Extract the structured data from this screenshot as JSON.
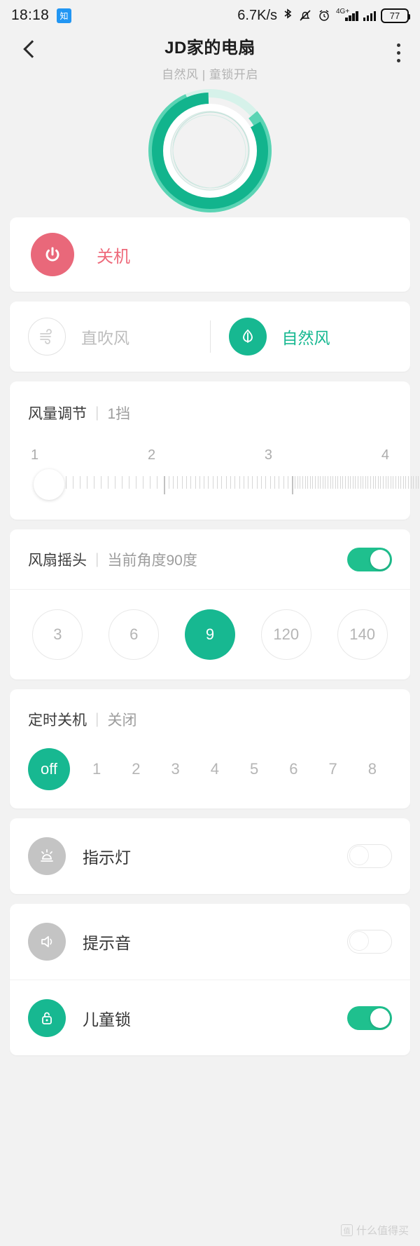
{
  "statusbar": {
    "time": "18:18",
    "app_badge": "知",
    "net_speed": "6.7K/s",
    "network_type": "4G+",
    "battery_level": "77",
    "icons": [
      "bluetooth-icon",
      "bell-muted-icon",
      "alarm-clock-icon",
      "signal-bars-icon",
      "signal-bars-icon",
      "battery-icon"
    ]
  },
  "header": {
    "title": "JD家的电扇",
    "subtitle": "自然风 | 童锁开启",
    "back_label": "返回",
    "menu_label": "更多"
  },
  "power": {
    "label": "关机",
    "color": "#e9687a"
  },
  "mode": {
    "options": [
      {
        "label": "直吹风",
        "active": false,
        "icon": "direct-wind-icon"
      },
      {
        "label": "自然风",
        "active": true,
        "icon": "natural-wind-icon"
      }
    ]
  },
  "speed": {
    "title": "风量调节",
    "separator": "|",
    "value": "1挡",
    "ticks": [
      "1",
      "2",
      "3",
      "4"
    ],
    "current": 1
  },
  "swing": {
    "title": "风扇摇头",
    "separator": "|",
    "value": "当前角度90度",
    "enabled": true,
    "angles": [
      {
        "label": "3",
        "selected": false
      },
      {
        "label": "6",
        "selected": false
      },
      {
        "label": "9",
        "selected": true
      },
      {
        "label": "120",
        "selected": false
      },
      {
        "label": "140",
        "selected": false
      }
    ]
  },
  "timer": {
    "title": "定时关机",
    "separator": "|",
    "value": "关闭",
    "options": [
      "off",
      "1",
      "2",
      "3",
      "4",
      "5",
      "6",
      "7",
      "8"
    ],
    "selected": "off"
  },
  "switches": [
    {
      "label": "指示灯",
      "icon": "indicator-light-icon",
      "on": false,
      "icon_style": "gray"
    },
    {
      "label": "提示音",
      "icon": "speaker-icon",
      "on": false,
      "icon_style": "gray"
    },
    {
      "label": "儿童锁",
      "icon": "child-lock-icon",
      "on": true,
      "icon_style": "teal"
    }
  ],
  "watermark": {
    "text": "什么值得买",
    "badge": "值"
  },
  "theme": {
    "accent": "#17b891",
    "danger": "#e9687a",
    "bg": "#f2f2f2",
    "card": "#ffffff"
  }
}
